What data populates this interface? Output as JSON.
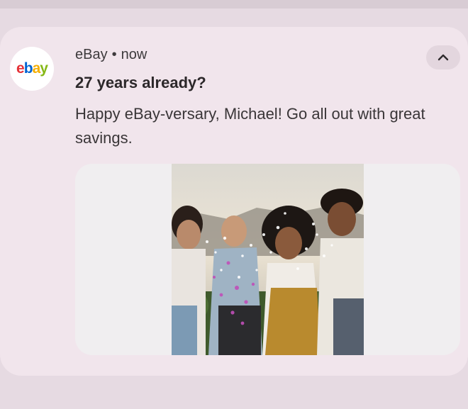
{
  "notification": {
    "app_logo": {
      "icon": "ebay-logo",
      "letters": [
        "e",
        "b",
        "a",
        "y"
      ],
      "colors": [
        "#e53238",
        "#0064d2",
        "#f5af02",
        "#86b817"
      ]
    },
    "app_name": "eBay",
    "separator": "•",
    "time": "now",
    "expand_icon": "chevron-up-icon",
    "title": "27 years already?",
    "body": "Happy eBay-versary, Michael! Go all out with great savings.",
    "image": {
      "icon": "photo-friends-blowing-confetti"
    }
  },
  "colors": {
    "background": "#e6dae2",
    "card": "#f1e5ec",
    "title_text": "#2c282a",
    "body_text": "#3a3638"
  }
}
